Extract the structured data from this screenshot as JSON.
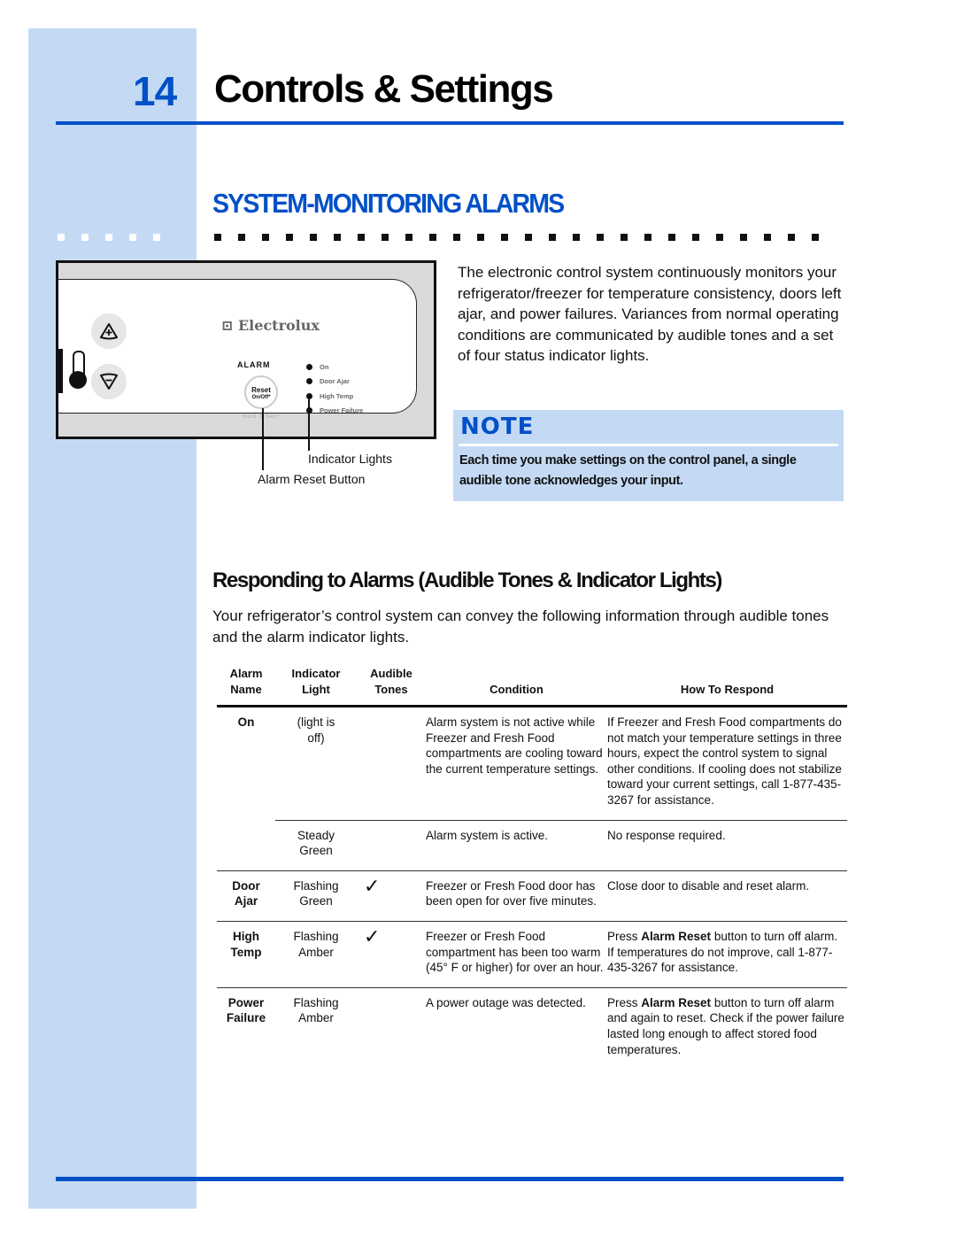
{
  "header": {
    "chapter_number": "14",
    "chapter_title": "Controls & Settings",
    "section_title": "SYSTEM-MONITORING ALARMS"
  },
  "colors": {
    "accent_blue": "#0050c8",
    "sidebar_blue": "#c4daf4"
  },
  "panel_graphic": {
    "brand": "Electrolux",
    "brand_icon": "electrolux-logo-icon",
    "increase_icon": "plus-triangle-icon",
    "decrease_icon": "minus-triangle-icon",
    "thermometer_icon": "thermometer-icon",
    "alarm_label": "ALARM",
    "reset_label": "Reset",
    "reset_sublabel": "On/Off*",
    "hold_note": "Hold 3 Sec*",
    "indicators": [
      "On",
      "Door Ajar",
      "High Temp",
      "Power Failure"
    ],
    "callout_indicator_lights": "Indicator Lights",
    "callout_alarm_reset": "Alarm Reset Button"
  },
  "intro_text": "The electronic control system continuously monitors your refrigerator/freezer for temperature consistency, doors left ajar, and power failures. Variances from normal operating conditions are communicated by audible tones and a set of four status indicator lights.",
  "note": {
    "title": "NOTE",
    "text": "Each time you make settings on the control panel, a single audible tone acknowledges your input."
  },
  "responding": {
    "title": "Responding to Alarms (Audible Tones & Indicator Lights)",
    "intro": "Your refrigerator’s control system can convey the following information through audible tones and the alarm indicator lights."
  },
  "table": {
    "headers": {
      "name_1": "Alarm",
      "name_2": "Name",
      "light_1": "Indicator",
      "light_2": "Light",
      "tones_1": "Audible",
      "tones_2": "Tones",
      "condition": "Condition",
      "respond": "How To Respond"
    },
    "rows": [
      {
        "name_1": "On",
        "name_2": "",
        "light_1": "(light is",
        "light_2": "off)",
        "tone": "",
        "condition": "Alarm system is not active while Freezer and Fresh Food compartments are cooling toward the current temperature settings.",
        "respond_pre": "",
        "respond_bold": "",
        "respond": "If Freezer and Fresh Food compartments do not match your temperature settings in three hours, expect the control system to signal other conditions. If cooling does not stabilize toward your current settings, call 1-877-435-3267 for assistance."
      },
      {
        "name_1": "",
        "name_2": "",
        "light_1": "Steady",
        "light_2": "Green",
        "tone": "",
        "condition": "Alarm system is active.",
        "respond_pre": "",
        "respond_bold": "",
        "respond": "No response required."
      },
      {
        "name_1": "Door",
        "name_2": "Ajar",
        "light_1": "Flashing",
        "light_2": "Green",
        "tone": "✓",
        "condition": "Freezer or Fresh Food door has been open for over five minutes.",
        "respond_pre": "",
        "respond_bold": "",
        "respond": "Close door to disable and reset alarm."
      },
      {
        "name_1": "High",
        "name_2": "Temp",
        "light_1": "Flashing",
        "light_2": "Amber",
        "tone": "✓",
        "condition": "Freezer or Fresh Food compartment has been too warm (45° F or higher) for over an hour.",
        "respond_pre": "Press ",
        "respond_bold": "Alarm Reset",
        "respond": " button to turn off alarm. If temperatures do not improve, call 1-877-435-3267 for assistance."
      },
      {
        "name_1": "Power",
        "name_2": "Failure",
        "light_1": "Flashing",
        "light_2": "Amber",
        "tone": "",
        "condition": "A power outage was detected.",
        "respond_pre": "Press ",
        "respond_bold": "Alarm Reset",
        "respond": " button to turn off alarm and again to reset. Check if the power failure lasted long enough to affect stored food temperatures."
      }
    ]
  }
}
